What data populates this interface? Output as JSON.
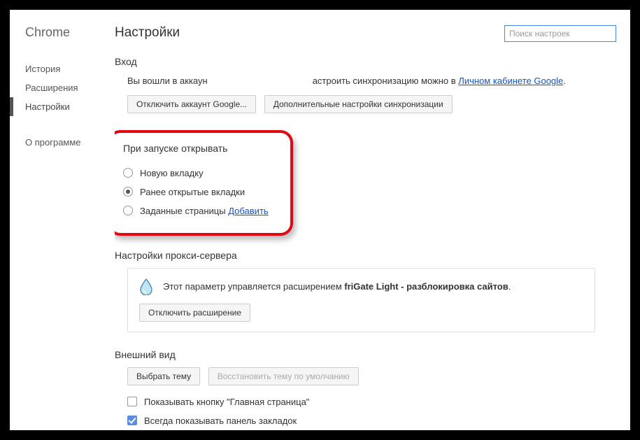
{
  "sidebar": {
    "title": "Chrome",
    "items": [
      {
        "label": "История",
        "key": "history"
      },
      {
        "label": "Расширения",
        "key": "extensions"
      },
      {
        "label": "Настройки",
        "key": "settings",
        "active": true
      }
    ],
    "about": "О программе"
  },
  "header": {
    "title": "Настройки",
    "search_placeholder": "Поиск настроек"
  },
  "login": {
    "title": "Вход",
    "text_before": "Вы вошли в аккаун",
    "text_after": "астроить синхронизацию можно в ",
    "link_text": "Личном кабинете Google",
    "period": ".",
    "disconnect_btn": "Отключить аккаунт Google...",
    "sync_btn": "Дополнительные настройки синхронизации"
  },
  "startup": {
    "title": "При запуске открывать",
    "options": [
      {
        "label": "Новую вкладку",
        "checked": false
      },
      {
        "label": "Ранее открытые вкладки",
        "checked": true
      },
      {
        "label": "Заданные страницы",
        "checked": false,
        "link": "Добавить"
      }
    ]
  },
  "proxy": {
    "title": "Настройки прокси-сервера",
    "info_prefix": "Этот параметр управляется расширением ",
    "info_bold": "friGate Light - разблокировка сайтов",
    "info_suffix": ".",
    "disable_btn": "Отключить расширение"
  },
  "appearance": {
    "title": "Внешний вид",
    "choose_theme_btn": "Выбрать тему",
    "reset_theme_btn": "Восстановить тему по умолчанию",
    "checks": [
      {
        "label": "Показывать кнопку \"Главная страница\"",
        "checked": false
      },
      {
        "label": "Всегда показывать панель закладок",
        "checked": true
      }
    ]
  }
}
